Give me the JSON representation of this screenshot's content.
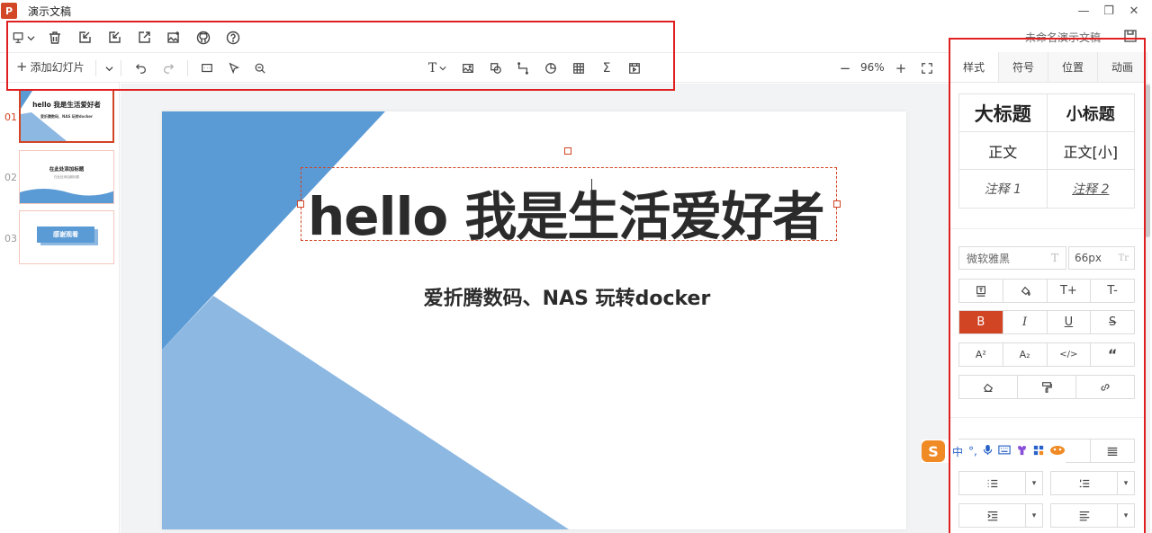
{
  "app": {
    "logo_letter": "P",
    "title": "演示文稿",
    "project_name": "未命名演示文稿"
  },
  "window_controls": [
    "—",
    "❐",
    "✕"
  ],
  "toolbar": {
    "row1_icons": [
      "slideshow-icon",
      "delete-icon",
      "import-icon",
      "export-ppt-icon",
      "share-icon",
      "image-export-icon",
      "github-icon",
      "help-icon"
    ],
    "add_slide_label": "添加幻灯片",
    "zoom_level": "96%"
  },
  "thumbnails": [
    {
      "num": "01",
      "title": "hello 我是生活爱好者",
      "subtitle": "爱折腾数码、NAS 玩转docker",
      "active": true
    },
    {
      "num": "02",
      "title": "在此处添加标题",
      "subtitle": "在此处添加副标题"
    },
    {
      "num": "03",
      "title": "感谢观看"
    }
  ],
  "slide": {
    "title": "hello 我是生活爱好者",
    "subtitle": "爱折腾数码、NAS 玩转docker"
  },
  "panel": {
    "tabs": [
      "样式",
      "符号",
      "位置",
      "动画"
    ],
    "active_tab": "样式",
    "presets": {
      "big_title": "大标题",
      "small_title": "小标题",
      "body": "正文",
      "body_small": "正文[小]",
      "note1": "注释 1",
      "note2": "注释 2"
    },
    "font_family": "微软雅黑",
    "font_size": "66px",
    "font_family_glyph": "T",
    "font_size_glyph": "Tr",
    "size_up": "T+",
    "size_down": "T-",
    "bold": "B",
    "italic": "I",
    "underline": "U",
    "strike": "S",
    "superscript": "A²",
    "subscript": "A₂",
    "code": "</>",
    "quote": "“"
  },
  "ime": {
    "logo": "S",
    "mode": "中",
    "punct": "°,"
  },
  "colors": {
    "accent": "#d14424",
    "slide_blue_dark": "#5b9bd5",
    "slide_blue_light": "#8db8e2",
    "annotation": "#e02020"
  }
}
